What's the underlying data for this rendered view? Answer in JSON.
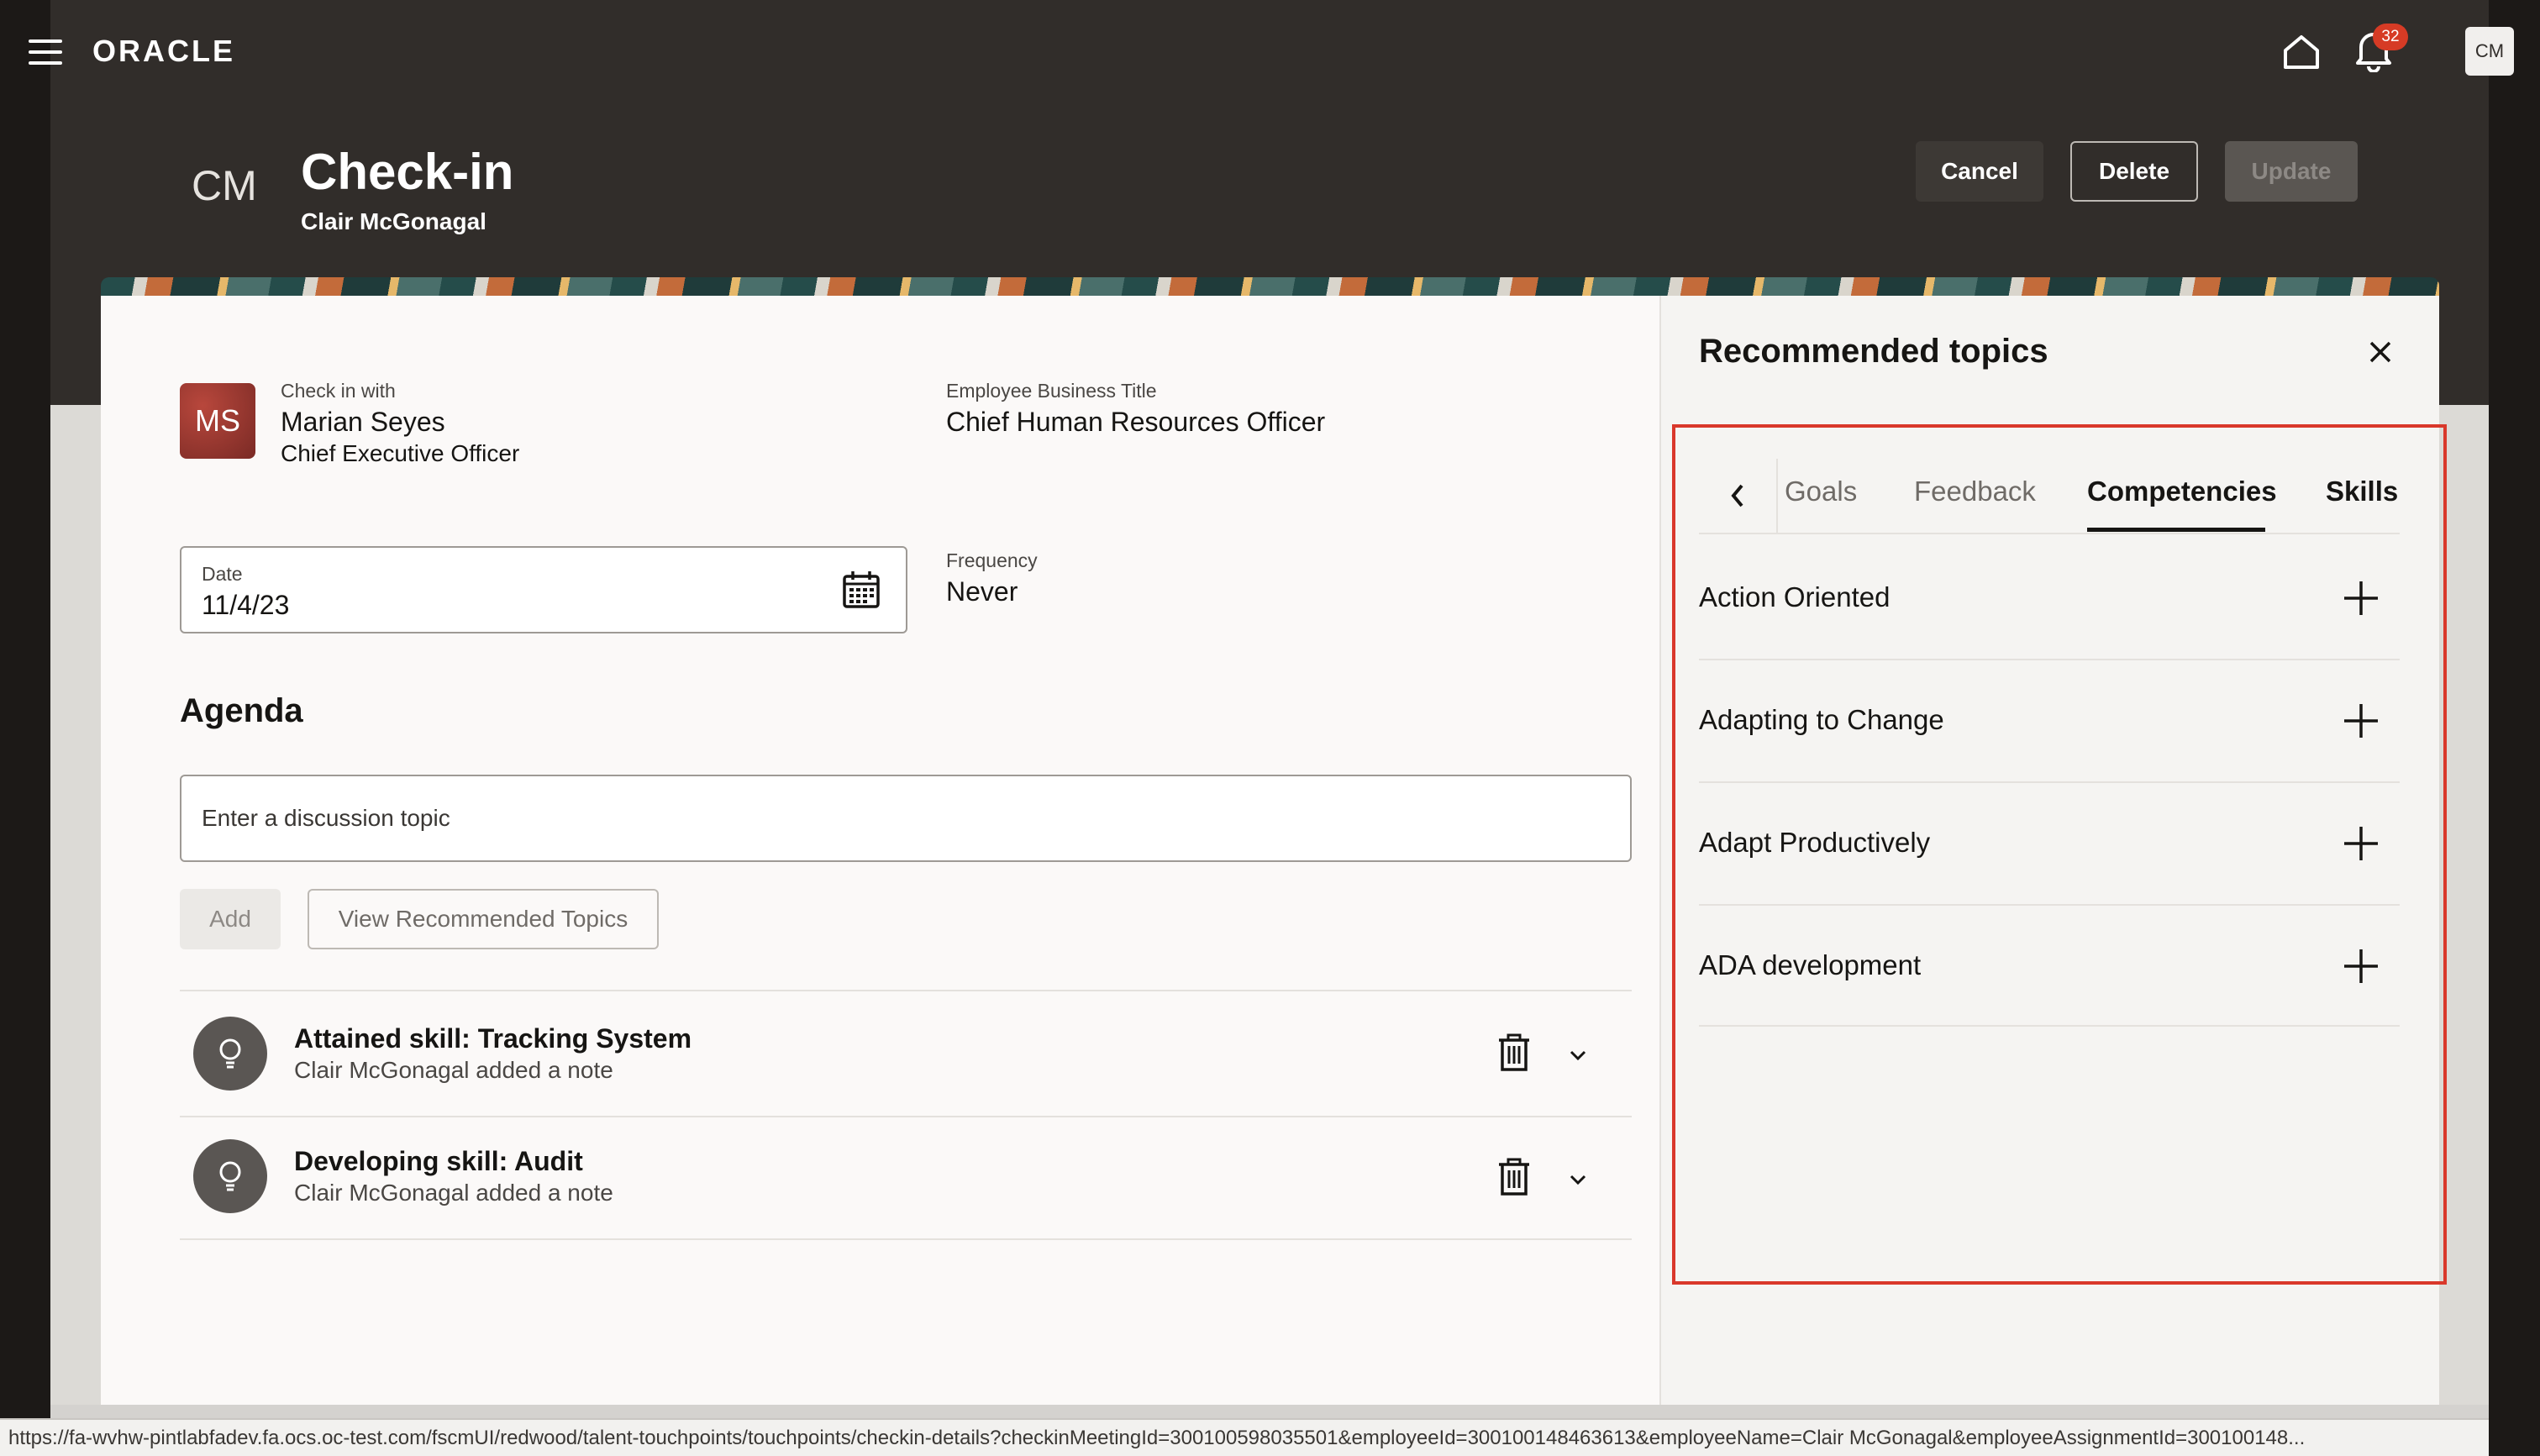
{
  "header": {
    "brand": "ORACLE",
    "notifications_count": "32",
    "user_initials": "CM"
  },
  "page": {
    "owner_initials": "CM",
    "title": "Check-in",
    "subtitle": "Clair McGonagal",
    "cancel_label": "Cancel",
    "delete_label": "Delete",
    "update_label": "Update"
  },
  "checkin": {
    "with_label": "Check in with",
    "with_initials": "MS",
    "with_name": "Marian Seyes",
    "with_title": "Chief Executive Officer",
    "business_title_label": "Employee Business Title",
    "business_title_value": "Chief Human Resources Officer",
    "date_label": "Date",
    "date_value": "11/4/23",
    "frequency_label": "Frequency",
    "frequency_value": "Never"
  },
  "agenda": {
    "heading": "Agenda",
    "topic_placeholder": "Enter a discussion topic",
    "add_label": "Add",
    "view_recommended_label": "View Recommended Topics",
    "items": [
      {
        "title": "Attained skill: Tracking System",
        "sub": "Clair McGonagal added a note"
      },
      {
        "title": "Developing skill: Audit",
        "sub": "Clair McGonagal added a note"
      }
    ]
  },
  "recommended": {
    "title": "Recommended topics",
    "tabs": [
      "Goals",
      "Feedback",
      "Competencies",
      "Skills"
    ],
    "active_tab": "Competencies",
    "topics": [
      "Action Oriented",
      "Adapting to Change",
      "Adapt Productively",
      "ADA development"
    ]
  },
  "status_url": "https://fa-wvhw-pintlabfadev.fa.ocs.oc-test.com/fscmUI/redwood/talent-touchpoints/touchpoints/checkin-details?checkinMeetingId=300100598035501&employeeId=300100148463613&employeeName=Clair McGonagal&employeeAssignmentId=300100148..."
}
